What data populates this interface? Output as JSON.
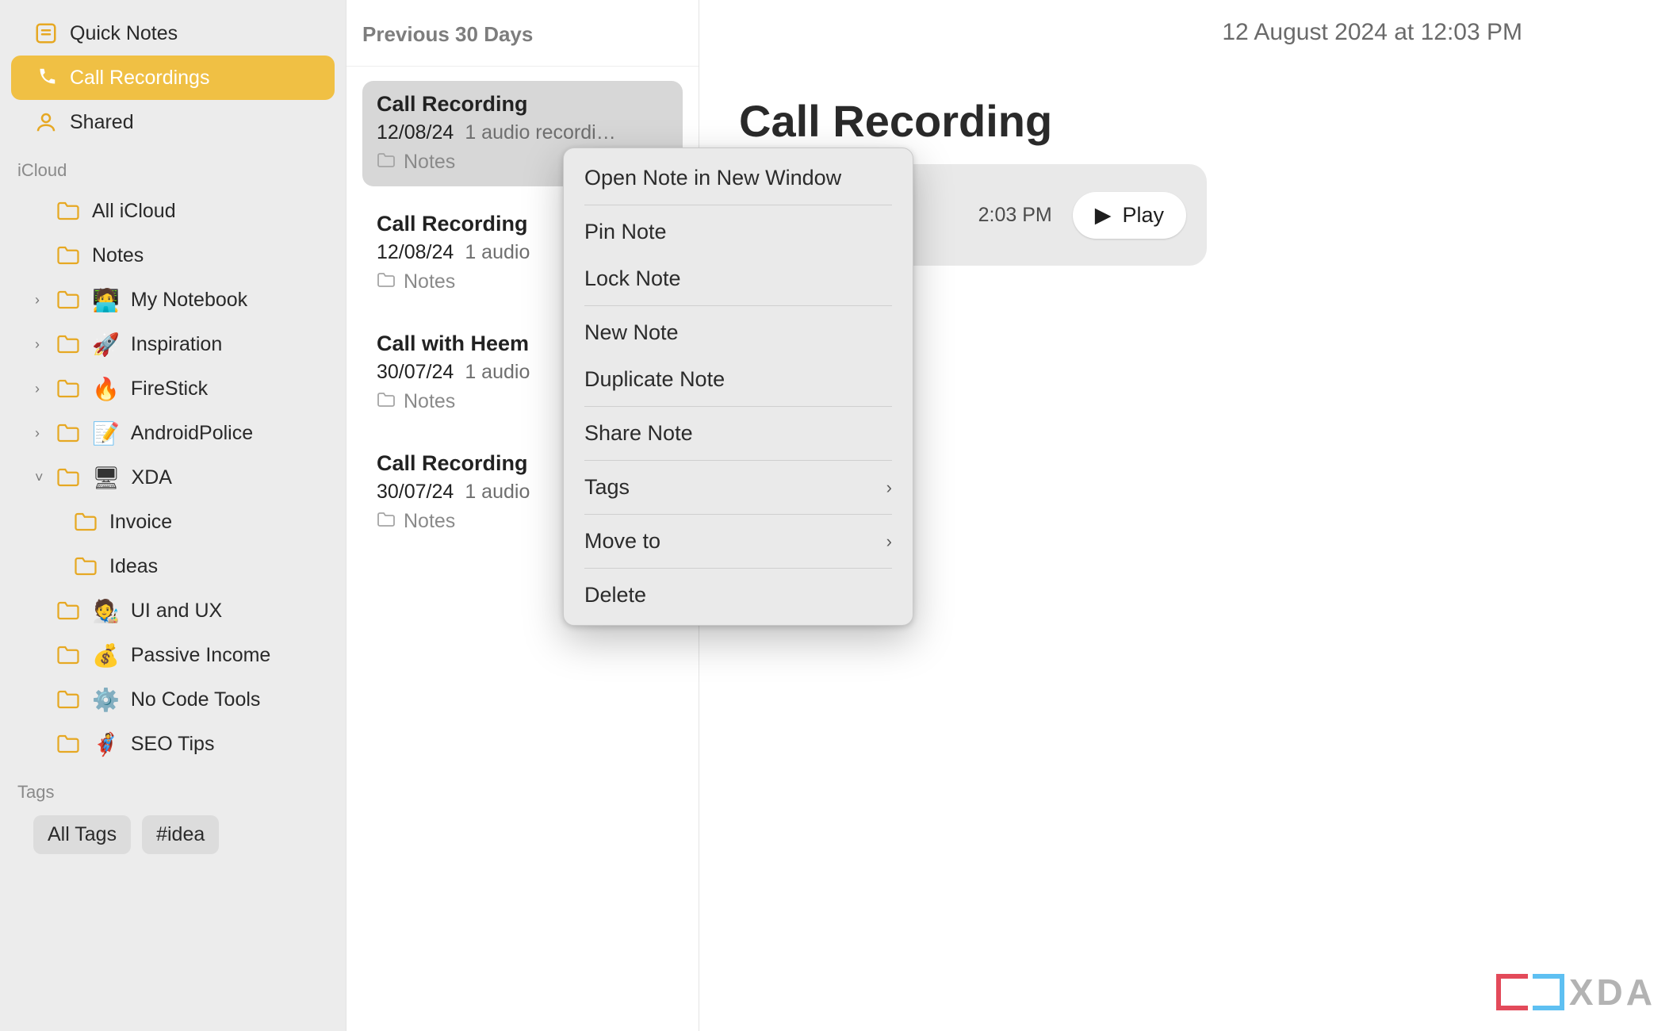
{
  "sidebar": {
    "top": [
      {
        "label": "Quick Notes",
        "icon": "quick-notes-icon",
        "selected": false
      },
      {
        "label": "Call Recordings",
        "icon": "call-record-icon",
        "selected": true
      },
      {
        "label": "Shared",
        "icon": "shared-icon",
        "selected": false
      }
    ],
    "section1_header": "iCloud",
    "icloud": [
      {
        "label": "All iCloud",
        "expandable": false,
        "expanded": false,
        "indent": 1
      },
      {
        "label": "Notes",
        "expandable": false,
        "expanded": false,
        "indent": 1
      },
      {
        "label": "My Notebook",
        "expandable": true,
        "expanded": false,
        "emoji": "🧑‍💻",
        "indent": 1
      },
      {
        "label": "Inspiration",
        "expandable": true,
        "expanded": false,
        "emoji": "🚀",
        "indent": 1
      },
      {
        "label": "FireStick",
        "expandable": true,
        "expanded": false,
        "emoji": "🔥",
        "indent": 1
      },
      {
        "label": "AndroidPolice",
        "expandable": true,
        "expanded": false,
        "emoji": "📝",
        "indent": 1
      },
      {
        "label": "XDA",
        "expandable": true,
        "expanded": true,
        "emoji": "🖥",
        "indent": 1
      },
      {
        "label": "Invoice",
        "expandable": false,
        "expanded": false,
        "indent": 2
      },
      {
        "label": "Ideas",
        "expandable": false,
        "expanded": false,
        "indent": 2
      },
      {
        "label": "UI and UX",
        "expandable": false,
        "expanded": false,
        "emoji": "🧑‍🎨",
        "indent": 1
      },
      {
        "label": "Passive Income",
        "expandable": false,
        "expanded": false,
        "emoji": "💰",
        "indent": 1
      },
      {
        "label": "No Code Tools",
        "expandable": false,
        "expanded": false,
        "emoji": "⚙️",
        "indent": 1
      },
      {
        "label": "SEO Tips",
        "expandable": false,
        "expanded": false,
        "emoji": "🦸",
        "indent": 1
      }
    ],
    "tags_header": "Tags",
    "tags": [
      "All Tags",
      "#idea"
    ]
  },
  "note_list": {
    "header": "Previous 30 Days",
    "items": [
      {
        "title": "Call Recording",
        "date": "12/08/24",
        "summary": "1 audio recordi…",
        "folder": "Notes",
        "selected": true
      },
      {
        "title": "Call Recording",
        "date": "12/08/24",
        "summary": "1 audio",
        "folder": "Notes",
        "selected": false
      },
      {
        "title": "Call with Heem",
        "date": "30/07/24",
        "summary": "1 audio",
        "folder": "Notes",
        "selected": false
      },
      {
        "title": "Call Recording",
        "date": "30/07/24",
        "summary": "1 audio",
        "folder": "Notes",
        "selected": false
      }
    ]
  },
  "note_view": {
    "timestamp": "12 August 2024 at 12:03 PM",
    "title": "Call Recording",
    "audio_time_suffix": "2:03 PM",
    "play_label": "Play"
  },
  "context_menu": {
    "items": [
      {
        "label": "Open Note in New Window"
      },
      {
        "sep": true
      },
      {
        "label": "Pin Note"
      },
      {
        "label": "Lock Note"
      },
      {
        "sep": true
      },
      {
        "label": "New Note"
      },
      {
        "label": "Duplicate Note"
      },
      {
        "sep": true
      },
      {
        "label": "Share Note"
      },
      {
        "sep": true
      },
      {
        "label": "Tags",
        "submenu": true
      },
      {
        "sep": true
      },
      {
        "label": "Move to",
        "submenu": true
      },
      {
        "sep": true
      },
      {
        "label": "Delete"
      }
    ]
  },
  "watermark": "XDA"
}
